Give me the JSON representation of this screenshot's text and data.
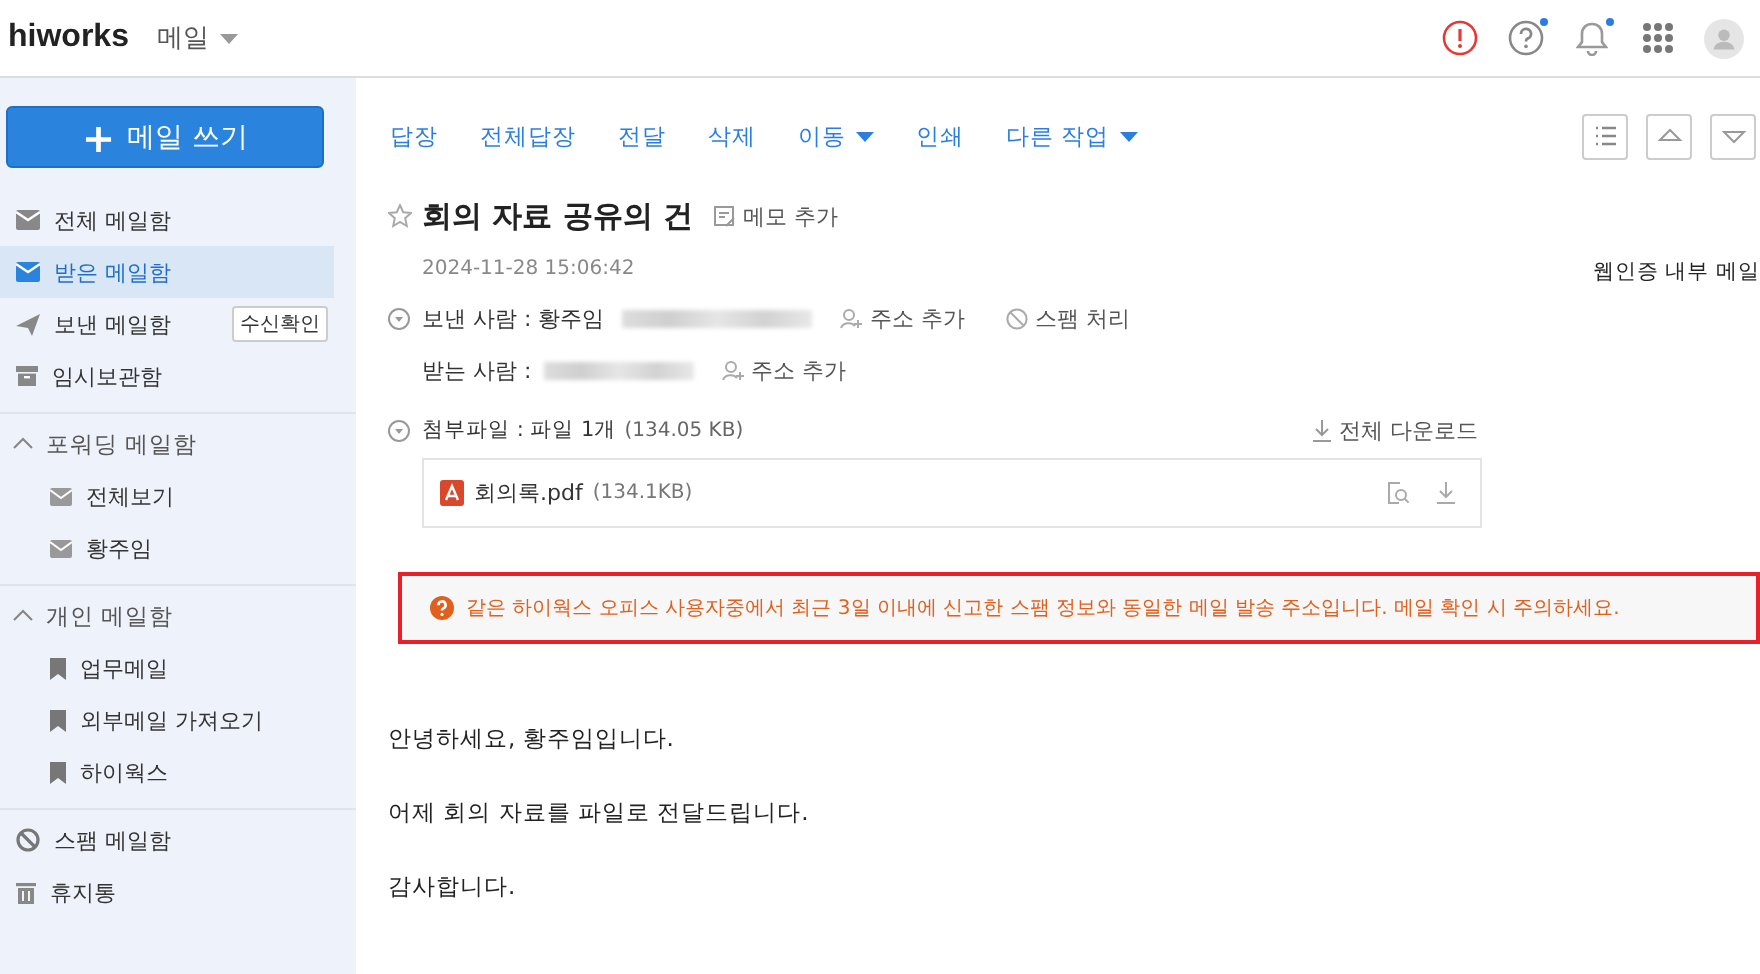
{
  "app": {
    "logo": "hiworks",
    "module": "메일"
  },
  "header_icons": [
    {
      "kind": "alert",
      "badge": false
    },
    {
      "kind": "help",
      "badge": true
    },
    {
      "kind": "bell",
      "badge": true
    },
    {
      "kind": "apps",
      "badge": false
    },
    {
      "kind": "avatar",
      "badge": false
    }
  ],
  "sidebar": {
    "compose": {
      "icon": "+",
      "label": "메일 쓰기"
    },
    "groups": [
      {
        "items": [
          {
            "label": "전체 메일함",
            "kind": "envelope",
            "selected": false
          },
          {
            "label": "받은 메일함",
            "kind": "envelope",
            "selected": true
          },
          {
            "label": "보낸 메일함",
            "kind": "plane",
            "selected": false,
            "tag": "수신확인"
          },
          {
            "label": "임시보관함",
            "kind": "box",
            "selected": false
          }
        ]
      },
      {
        "title": "포워딩 메일함",
        "expanded": true,
        "items": [
          {
            "label": "전체보기",
            "kind": "subenvelope",
            "selected": false
          },
          {
            "label": "황주임",
            "kind": "subenvelope",
            "selected": false
          }
        ]
      },
      {
        "title": "개인 메일함",
        "expanded": true,
        "items": [
          {
            "label": "업무메일",
            "kind": "bookmark",
            "selected": false
          },
          {
            "label": "외부메일 가져오기",
            "kind": "bookmark",
            "selected": false
          },
          {
            "label": "하이웍스",
            "kind": "bookmark",
            "selected": false
          }
        ]
      },
      {
        "items": [
          {
            "label": "스팸 메일함",
            "kind": "ban",
            "selected": false
          },
          {
            "label": "휴지통",
            "kind": "trash",
            "selected": false
          }
        ]
      }
    ]
  },
  "toolbar": {
    "actions": [
      {
        "label": "답장",
        "dropdown": false
      },
      {
        "label": "전체답장",
        "dropdown": false
      },
      {
        "label": "전달",
        "dropdown": false
      },
      {
        "label": "삭제",
        "dropdown": false
      },
      {
        "label": "이동",
        "dropdown": true
      },
      {
        "label": "인쇄",
        "dropdown": false
      },
      {
        "label": "다른 작업",
        "dropdown": true
      }
    ],
    "buttons": [
      {
        "kind": "list"
      },
      {
        "kind": "up"
      },
      {
        "kind": "down"
      }
    ]
  },
  "message": {
    "starred": false,
    "subject": "회의 자료 공유의 건",
    "memo": "메모 추가",
    "date": "2024-11-28 15:06:42",
    "security": "웹인증 내부 메일",
    "sender": {
      "label": "보낸 사람 : 황주임",
      "add_address": "주소 추가",
      "spam": "스팸 처리"
    },
    "recipient": {
      "label": "받는 사람 :",
      "add_address": "주소 추가"
    },
    "attachments": {
      "label": "첨부파일 : 파일 1개",
      "size": "(134.05 KB)",
      "download_all": "전체 다운로드",
      "files": [
        {
          "name": "회의록.pdf",
          "size": "(134.1KB)"
        }
      ]
    },
    "warning": "같은 하이웍스 오피스 사용자중에서 최근 3일 이내에 신고한 스팸 정보와 동일한 메일 발송 주소입니다. 메일 확인 시 주의하세요.",
    "body": [
      "안녕하세요, 황주임입니다.",
      "어제 회의 자료를 파일로 전달드립니다.",
      "감사합니다."
    ]
  }
}
